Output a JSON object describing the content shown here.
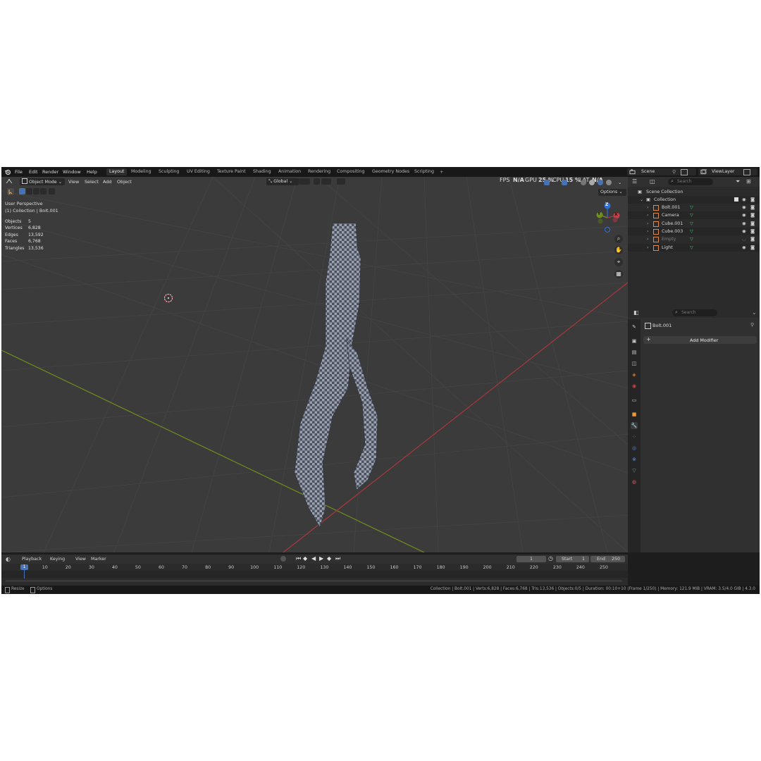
{
  "menu": [
    "File",
    "Edit",
    "Render",
    "Window",
    "Help"
  ],
  "workspaces": [
    "Layout",
    "Modeling",
    "Sculpting",
    "UV Editing",
    "Texture Paint",
    "Shading",
    "Animation",
    "Rendering",
    "Compositing",
    "Geometry Nodes",
    "Scripting"
  ],
  "active_workspace": "Layout",
  "add_workspace": "+",
  "scene": {
    "name": "Scene",
    "view_layer": "ViewLayer"
  },
  "header": {
    "mode": "Object Mode",
    "view": "View",
    "select": "Select",
    "add": "Add",
    "object": "Object",
    "transform": "Global",
    "options": "Options",
    "perf": {
      "fps_label": "FPS",
      "fps_value": "N/A",
      "gpu_label": "GPU",
      "gpu_value": "25 %",
      "cpu_label": "CPU",
      "cpu_value": "15 %",
      "lat_label": "LAT",
      "lat_value": "N/A"
    }
  },
  "overlay": {
    "view_name": "User Perspective",
    "collection": "(1) Collection | Bolt.001",
    "stats": [
      {
        "label": "Objects",
        "value": "5"
      },
      {
        "label": "Vertices",
        "value": "6,828"
      },
      {
        "label": "Edges",
        "value": "13,592"
      },
      {
        "label": "Faces",
        "value": "6,768"
      },
      {
        "label": "Triangles",
        "value": "13,536"
      }
    ]
  },
  "gizmo": {
    "z": "Z",
    "y": "Y",
    "x": "X"
  },
  "outliner": {
    "search_placeholder": "Search",
    "scene_collection": "Scene Collection",
    "collection": "Collection",
    "items": [
      {
        "name": "Bolt.001",
        "color": "#e08a4a",
        "visible": true
      },
      {
        "name": "Camera",
        "color": "#e08a4a",
        "visible": true
      },
      {
        "name": "Cube.001",
        "color": "#e08a4a",
        "visible": true
      },
      {
        "name": "Cube.003",
        "color": "#e08a4a",
        "visible": true
      },
      {
        "name": "Empty",
        "color": "#e08a4a",
        "visible": false
      },
      {
        "name": "Light",
        "color": "#e08a4a",
        "visible": true
      }
    ]
  },
  "properties": {
    "search_placeholder": "Search",
    "object_name": "Bolt.001",
    "add_modifier": "Add Modifier",
    "add_modifier_icon": "+"
  },
  "timeline": {
    "playback": "Playback",
    "keying": "Keying",
    "view": "View",
    "marker": "Marker",
    "current_frame": "1",
    "start_label": "Start",
    "start": "1",
    "end_label": "End",
    "end": "250",
    "ticks": [
      "10",
      "20",
      "30",
      "40",
      "50",
      "60",
      "70",
      "80",
      "90",
      "100",
      "110",
      "120",
      "130",
      "140",
      "150",
      "160",
      "170",
      "180",
      "190",
      "200",
      "210",
      "220",
      "230",
      "240",
      "250"
    ],
    "playhead": "1"
  },
  "status": {
    "resize": "Resize",
    "options": "Options",
    "info": "Collection | Bolt.001 | Verts:6,828 | Faces:6,768 | Tris:13,536 | Objects:0/5 | Duration: 00:10+10 (Frame 1/250) | Memory: 121.9 MiB | VRAM: 3.5/4.0 GiB | 4.3.0"
  },
  "colors": {
    "accent": "#4772b3",
    "x_axis": "#a8383c",
    "y_axis": "#6f8f1e",
    "z_axis": "#2d6fd6"
  }
}
